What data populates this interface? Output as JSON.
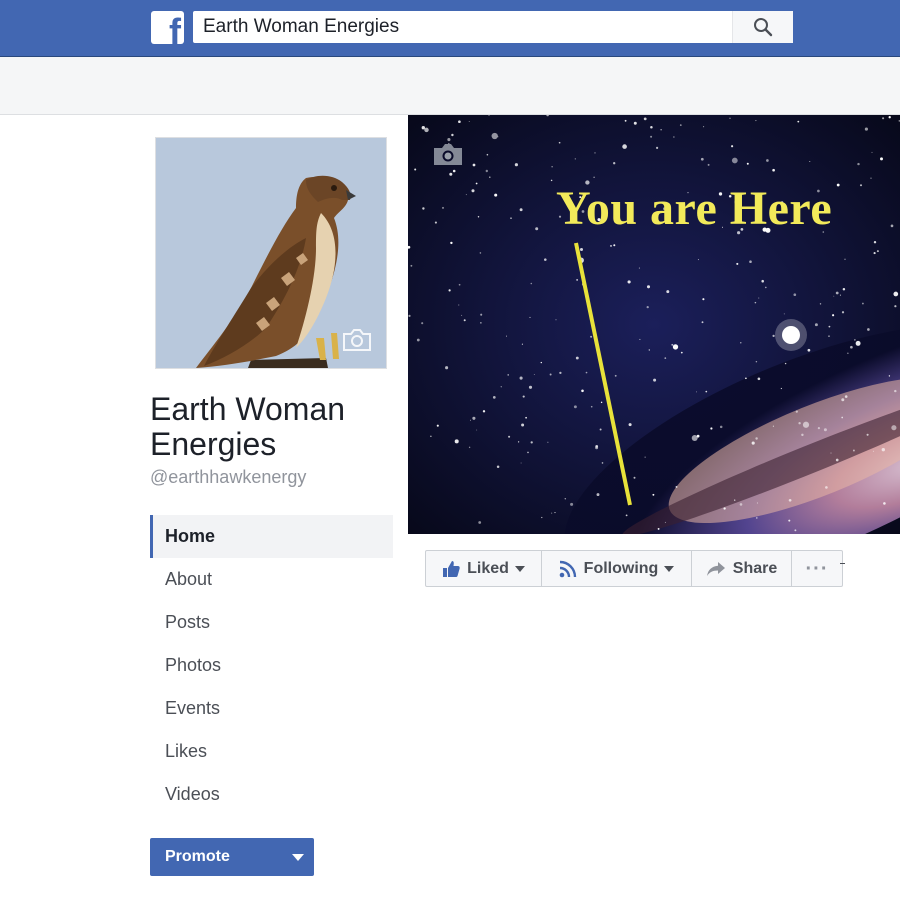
{
  "header": {
    "logo_icon": "facebook-f-icon",
    "logo_letter": "f",
    "search_value": "Earth Woman Energies",
    "search_icon": "search-icon"
  },
  "page": {
    "name": "Earth Woman Energies",
    "handle": "@earthhawkenergy"
  },
  "nav": {
    "items": [
      {
        "label": "Home",
        "active": true
      },
      {
        "label": "About"
      },
      {
        "label": "Posts"
      },
      {
        "label": "Photos"
      },
      {
        "label": "Events"
      },
      {
        "label": "Likes"
      },
      {
        "label": "Videos"
      }
    ]
  },
  "promote": {
    "label": "Promote"
  },
  "cover": {
    "text": "You are Here"
  },
  "actions": {
    "liked": "Liked",
    "following": "Following",
    "share": "Share",
    "more": "···"
  },
  "colors": {
    "brand": "#4267b2",
    "cover_text": "#f2ea5a",
    "nav_active_bg": "#f2f3f5"
  }
}
